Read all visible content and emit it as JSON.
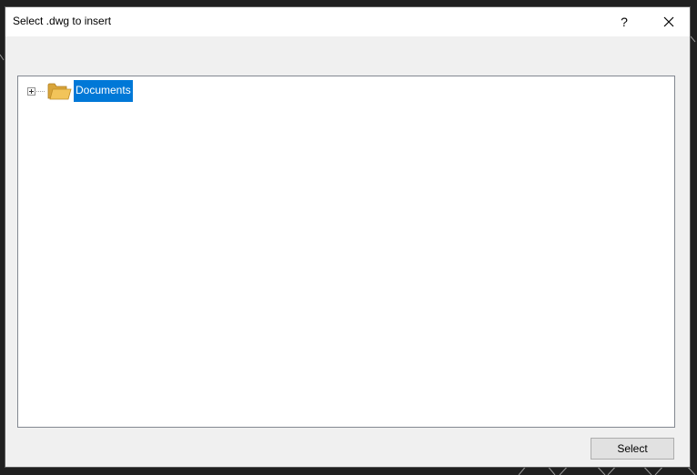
{
  "window": {
    "title": "Select .dwg to insert",
    "help_label": "?"
  },
  "tree": {
    "nodes": [
      {
        "label": "Documents",
        "icon": "folder-icon",
        "expanded": false,
        "selected": true
      }
    ]
  },
  "footer": {
    "select_label": "Select"
  },
  "colors": {
    "selection": "#0078d7",
    "dialog_bg": "#f0f0f0",
    "titlebar_bg": "#ffffff",
    "backdrop": "#202020"
  }
}
